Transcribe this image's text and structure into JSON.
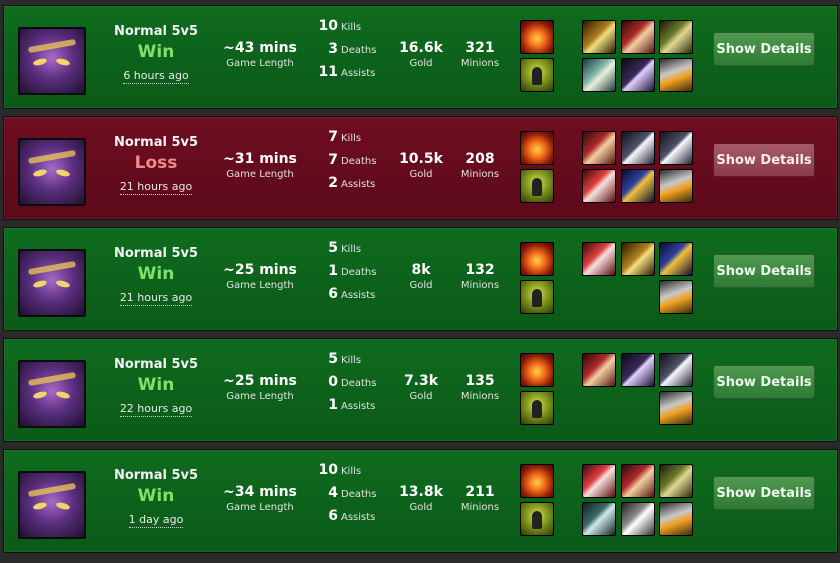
{
  "ui": {
    "details_label": "Show Details",
    "length_label": "Game Length",
    "gold_label": "Gold",
    "minions_label": "Minions",
    "kills_label": "Kills",
    "deaths_label": "Deaths",
    "assists_label": "Assists"
  },
  "matches": [
    {
      "mode": "Normal 5v5",
      "result": "Win",
      "time": "6 hours ago",
      "length": "~43 mins",
      "kills": "10",
      "deaths": "3",
      "assists": "11",
      "gold": "16.6k",
      "minions": "321"
    },
    {
      "mode": "Normal 5v5",
      "result": "Loss",
      "time": "21 hours ago",
      "length": "~31 mins",
      "kills": "7",
      "deaths": "7",
      "assists": "2",
      "gold": "10.5k",
      "minions": "208"
    },
    {
      "mode": "Normal 5v5",
      "result": "Win",
      "time": "21 hours ago",
      "length": "~25 mins",
      "kills": "5",
      "deaths": "1",
      "assists": "6",
      "gold": "8k",
      "minions": "132"
    },
    {
      "mode": "Normal 5v5",
      "result": "Win",
      "time": "22 hours ago",
      "length": "~25 mins",
      "kills": "5",
      "deaths": "0",
      "assists": "1",
      "gold": "7.3k",
      "minions": "135"
    },
    {
      "mode": "Normal 5v5",
      "result": "Win",
      "time": "1 day ago",
      "length": "~34 mins",
      "kills": "10",
      "deaths": "4",
      "assists": "6",
      "gold": "13.8k",
      "minions": "211"
    }
  ],
  "icons": {
    "portrait": "champion-portrait",
    "spell1": "ignite-spell-icon",
    "spell2": "ghost-spell-icon",
    "item": "item-icon"
  },
  "colors": {
    "win_bg": "#0d651c",
    "loss_bg": "#660c1d",
    "win_text": "#7fe06a",
    "loss_text": "#f08a8a",
    "page_bg": "#2a2a2a"
  }
}
